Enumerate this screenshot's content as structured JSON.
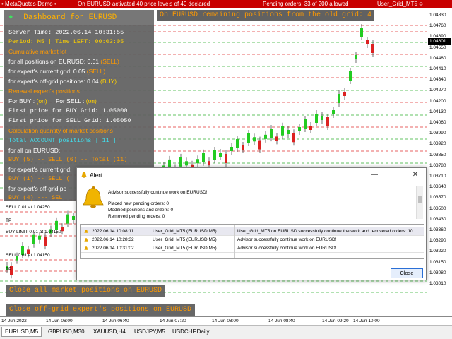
{
  "titlebar": {
    "left": "• MetaQuotes-Demo •",
    "activation": "On EURUSD  activated  40  price levels of  40  declared",
    "pending": "Pending orders:  33  of  200  allowed",
    "ea": "User_Grid_MT5",
    "smile": "☺"
  },
  "banner_top": "On EURUSD remaining positions from the old grid: 4",
  "dashboard": {
    "title": "Dashboard for EURUSD",
    "server_time": "Server Time:  2022.06.14 10:31:55",
    "period": "Period: M5 | Time LEFT: 00:03:05",
    "cum_lot_header": "Cumulative market lot",
    "all_positions_label": "for all positions on EURUSD: 0.01",
    "all_positions_side": "(SELL)",
    "current_grid_label": "for expert's current grid: 0.05",
    "current_grid_side": "(SELL)",
    "offgrid_label": "for expert's off-grid positions: 0.04",
    "offgrid_side": "(BUY)",
    "renewal_header": "Renewal expert's positions",
    "for_buy": "For BUY :",
    "for_buy_val": "(on)",
    "for_sell": "For SELL :",
    "for_sell_val": "(on)",
    "first_buy": "First price for BUY Grid:  1.05000",
    "first_sell": "First price for SELL Grid: 1.05050",
    "calc_header": "Calculation quantity of market positions",
    "total_account": "Total ACCOUNT positions | 11 |",
    "all_on": "for all on EURUSD:",
    "all_on_counts": "BUY (5) -- SELL (6) -- Total (11)",
    "current_grid2": "for expert's current grid:",
    "current_counts": "BUY (1) -- SELL (",
    "offgrid2": "for expert's off-grid po",
    "offgrid_counts": "BUY (4) --- SEL"
  },
  "buttons": {
    "close_market": "Close all market positions on EURUSD",
    "close_offgrid": "Close off-grid expert's positions on EURUSD"
  },
  "levels": {
    "sell1": "SELL 0.01 at 1.04250",
    "tp1": "TP",
    "buylimit": "BUY LIMIT 0.01 at 1.04150",
    "sell2": "SELL 0.01 at 1.04150",
    "tp2": "TP"
  },
  "price_axis": {
    "ticks": [
      "1.04830",
      "1.04760",
      "1.04690",
      "1.04550",
      "1.04480",
      "1.04410",
      "1.04340",
      "1.04270",
      "1.04200",
      "1.04130",
      "1.04060",
      "1.03990",
      "1.03920",
      "1.03850",
      "1.03780",
      "1.03710",
      "1.03640",
      "1.03570",
      "1.03500",
      "1.03430",
      "1.03360",
      "1.03290",
      "1.03220",
      "1.03150",
      "1.03080",
      "1.03010"
    ],
    "current": "1.04601"
  },
  "time_axis": [
    "14 Jun 2022",
    "14 Jun 06:00",
    "14 Jun 06:40",
    "14 Jun 07:20",
    "14 Jun 08:00",
    "14 Jun 08:40",
    "14 Jun 09:20",
    "14 Jun 10:00"
  ],
  "tabs": [
    "EURUSD,M5",
    "GBPUSD,M30",
    "XAUUSD,H4",
    "USDJPY,M5",
    "USDCHF,Daily"
  ],
  "alert": {
    "title": "Alert",
    "message": "Advisor successfully continue work on EURUSD!",
    "placed": "Placed new pending orders:  0",
    "modified": "Modified positions and orders:  0",
    "removed": "Removed pending orders:  0",
    "rows": [
      {
        "time": "2022.06.14 10:08:11",
        "ea": "User_Grid_MT5 (EURUSD,M5)",
        "msg": "User_Grid_MT5 on EURUSD successfully continue the work and recovered orders: 10"
      },
      {
        "time": "2022.06.14 10:28:32",
        "ea": "User_Grid_MT5 (EURUSD,M5)",
        "msg": "Advisor successfully continue work on EURUSD!"
      },
      {
        "time": "2022.06.14 10:31:02",
        "ea": "User_Grid_MT5 (EURUSD,M5)",
        "msg": "Advisor successfully continue work on EURUSD!"
      }
    ],
    "close_label": "Close",
    "min": "—",
    "close_x": "✕"
  },
  "colors": {
    "topbar": "#c80000",
    "bull": "#22cc22",
    "bear": "#dd2222",
    "grid_red": "#e03030",
    "grid_green": "#30b030"
  }
}
